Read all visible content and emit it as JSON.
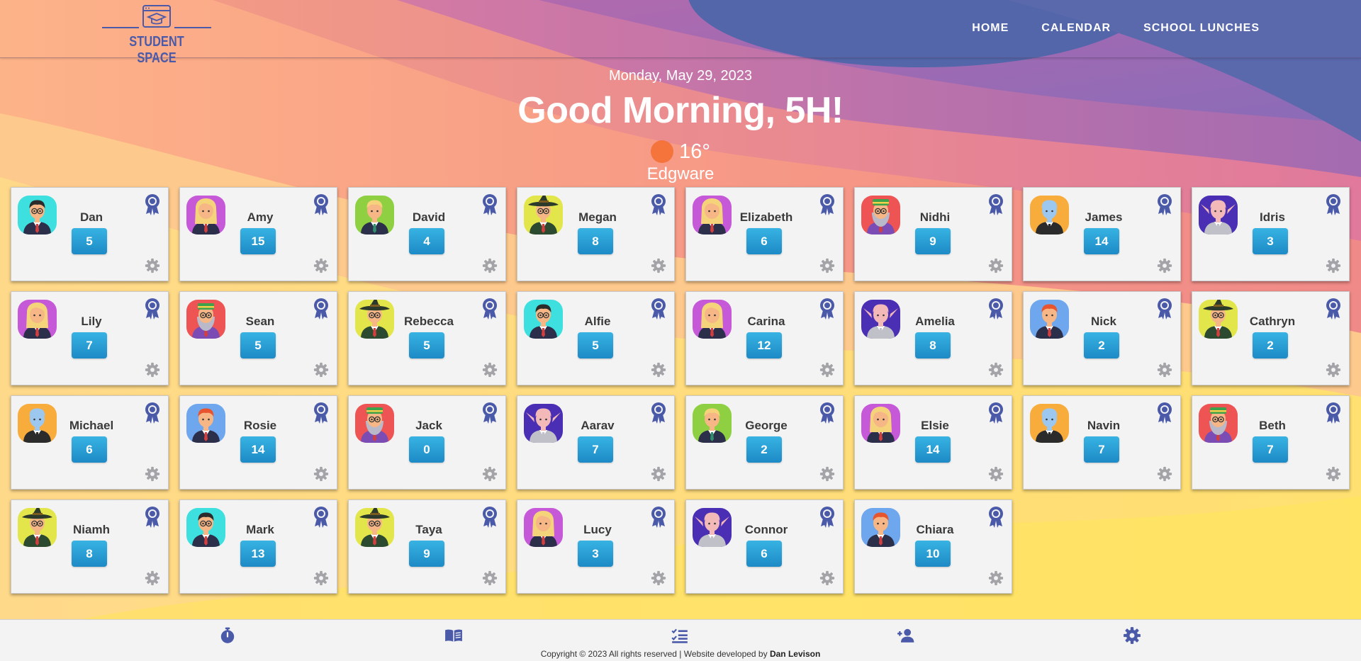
{
  "logo": {
    "text": "STUDENT SPACE"
  },
  "nav": {
    "items": [
      {
        "label": "HOME"
      },
      {
        "label": "CALENDAR"
      },
      {
        "label": "SCHOOL LUNCHES"
      }
    ]
  },
  "hero": {
    "date": "Monday, May 29, 2023",
    "greeting": "Good Morning, 5H!",
    "temperature": "16°",
    "location": "Edgware"
  },
  "avatar_styles": {
    "glasses_boy": {
      "bg": "#3ee0df",
      "hair": "#2b2b2b",
      "skin": "#f6b686",
      "shirt": "#2b2f4a",
      "tie": "#d33e3e",
      "glasses": true
    },
    "blonde_girl": {
      "bg": "#c659d8",
      "hair": "#f5d37a",
      "skin": "#f6b686",
      "shirt": "#2b2f4a",
      "tie": "#d33e3e",
      "glasses": false
    },
    "blonde_boy": {
      "bg": "#8fd043",
      "hair": "#f5d37a",
      "skin": "#f6b686",
      "shirt": "#2b2f4a",
      "tie": "#2f8e6b",
      "glasses": false
    },
    "witch": {
      "bg": "#e3e64a",
      "hair": "#2b2b2b",
      "skin": "#f6b686",
      "shirt": "#2b4a2f",
      "tie": "#d33e3e",
      "glasses": true,
      "hat": true
    },
    "old_wizard": {
      "bg": "#ee5454",
      "hair": "#b9b9c9",
      "skin": "#f6b686",
      "shirt": "#7b4db4",
      "tie": "#d33e3e",
      "glasses": true,
      "cap": true
    },
    "blue_alien": {
      "bg": "#f8ac3c",
      "hair": "#9cc7ee",
      "skin": "#9cc7ee",
      "shirt": "#2b2b2b",
      "tie": "#2b2b2b",
      "glasses": false
    },
    "elf": {
      "bg": "#4a2fb5",
      "hair": "#f3b8b8",
      "skin": "#f3b8b8",
      "shirt": "#c0c0c8",
      "tie": "#c0c0c8",
      "glasses": false,
      "ears": true
    },
    "redhead": {
      "bg": "#6ea7ee",
      "hair": "#e8542d",
      "skin": "#f6b686",
      "shirt": "#2b2f4a",
      "tie": "#d33e3e",
      "glasses": false
    }
  },
  "students": [
    {
      "name": "Dan",
      "points": 5,
      "avatar": "glasses_boy"
    },
    {
      "name": "Amy",
      "points": 15,
      "avatar": "blonde_girl"
    },
    {
      "name": "David",
      "points": 4,
      "avatar": "blonde_boy"
    },
    {
      "name": "Megan",
      "points": 8,
      "avatar": "witch"
    },
    {
      "name": "Elizabeth",
      "points": 6,
      "avatar": "blonde_girl"
    },
    {
      "name": "Nidhi",
      "points": 9,
      "avatar": "old_wizard"
    },
    {
      "name": "James",
      "points": 14,
      "avatar": "blue_alien"
    },
    {
      "name": "Idris",
      "points": 3,
      "avatar": "elf"
    },
    {
      "name": "Lily",
      "points": 7,
      "avatar": "blonde_girl"
    },
    {
      "name": "Sean",
      "points": 5,
      "avatar": "old_wizard"
    },
    {
      "name": "Rebecca",
      "points": 5,
      "avatar": "witch"
    },
    {
      "name": "Alfie",
      "points": 5,
      "avatar": "glasses_boy"
    },
    {
      "name": "Carina",
      "points": 12,
      "avatar": "blonde_girl"
    },
    {
      "name": "Amelia",
      "points": 8,
      "avatar": "elf"
    },
    {
      "name": "Nick",
      "points": 2,
      "avatar": "redhead"
    },
    {
      "name": "Cathryn",
      "points": 2,
      "avatar": "witch"
    },
    {
      "name": "Michael",
      "points": 6,
      "avatar": "blue_alien"
    },
    {
      "name": "Rosie",
      "points": 14,
      "avatar": "redhead"
    },
    {
      "name": "Jack",
      "points": 0,
      "avatar": "old_wizard"
    },
    {
      "name": "Aarav",
      "points": 7,
      "avatar": "elf"
    },
    {
      "name": "George",
      "points": 2,
      "avatar": "blonde_boy"
    },
    {
      "name": "Elsie",
      "points": 14,
      "avatar": "blonde_girl"
    },
    {
      "name": "Navin",
      "points": 7,
      "avatar": "blue_alien"
    },
    {
      "name": "Beth",
      "points": 7,
      "avatar": "old_wizard"
    },
    {
      "name": "Niamh",
      "points": 8,
      "avatar": "witch"
    },
    {
      "name": "Mark",
      "points": 13,
      "avatar": "glasses_boy"
    },
    {
      "name": "Taya",
      "points": 9,
      "avatar": "witch"
    },
    {
      "name": "Lucy",
      "points": 3,
      "avatar": "blonde_girl"
    },
    {
      "name": "Connor",
      "points": 6,
      "avatar": "elf"
    },
    {
      "name": "Chiara",
      "points": 10,
      "avatar": "redhead"
    }
  ],
  "footer": {
    "icons": [
      "stopwatch-icon",
      "book-icon",
      "checklist-icon",
      "add-user-icon",
      "gear-icon"
    ],
    "copyright_prefix": "Copyright © 2023 All rights reserved | Website developed by ",
    "developer": "Dan Levison"
  },
  "colors": {
    "accent": "#4a5aa8",
    "score_badge": "#2aa0d6",
    "icon_gray": "#a4a4a8"
  }
}
